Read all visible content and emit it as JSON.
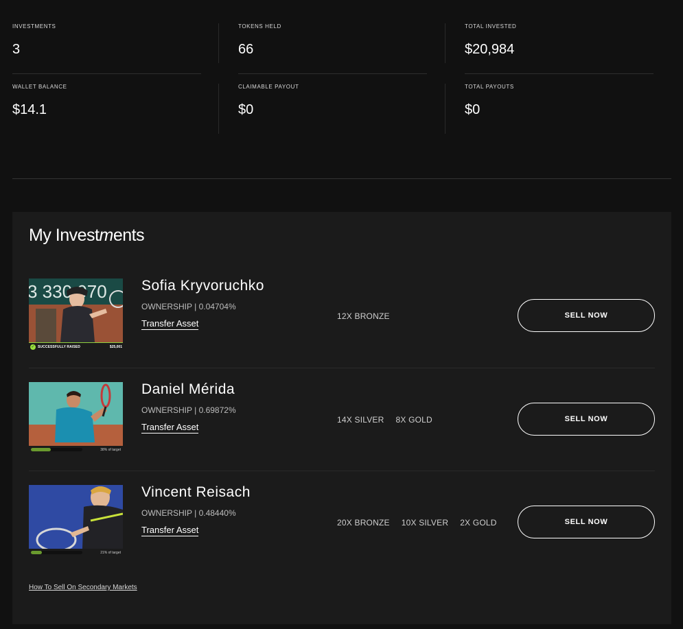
{
  "stats": [
    {
      "label": "INVESTMENTS",
      "value": "3"
    },
    {
      "label": "TOKENS HELD",
      "value": "66"
    },
    {
      "label": "TOTAL INVESTED",
      "value": "$20,984"
    },
    {
      "label": "WALLET BALANCE",
      "value": "$14.1"
    },
    {
      "label": "CLAIMABLE PAYOUT",
      "value": "$0"
    },
    {
      "label": "TOTAL PAYOUTS",
      "value": "$0"
    }
  ],
  "investments_panel": {
    "title_part1": "My Inv",
    "title_part2": "est",
    "title_part3": "m",
    "title_part4": "ents",
    "sell_label": "SELL NOW",
    "transfer_label": "Transfer Asset",
    "help_link": "How To Sell On Secondary Markets"
  },
  "investments": [
    {
      "name": "Sofia Kryvoruchko",
      "ownership": "OWNERSHIP | 0.04704%",
      "tiers": [
        "12X BRONZE"
      ],
      "status_text": "SUCCESSFULLY RAISED",
      "raised_amount": "$25,001",
      "photo_icon": "tennis-player-photo"
    },
    {
      "name": "Daniel Mérida",
      "ownership": "OWNERSHIP | 0.69872%",
      "tiers": [
        "14X SILVER",
        "8X GOLD"
      ],
      "progress_text": "38% of target",
      "progress": 0.38,
      "photo_icon": "tennis-player-photo"
    },
    {
      "name": "Vincent Reisach",
      "ownership": "OWNERSHIP | 0.48440%",
      "tiers": [
        "20X BRONZE",
        "10X SILVER",
        "2X GOLD"
      ],
      "progress_text": "21% of target",
      "progress": 0.21,
      "photo_icon": "tennis-player-photo"
    }
  ],
  "colors": {
    "background": "#111111",
    "panel": "#1b1b1b",
    "accent_green": "#8fd13f"
  }
}
